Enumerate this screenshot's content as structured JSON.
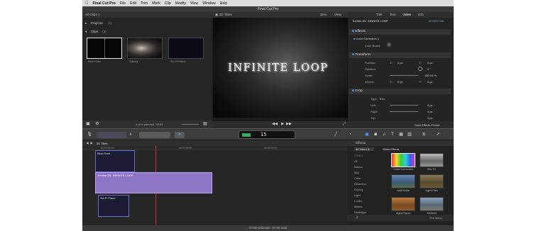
{
  "menubar": {
    "apple": "",
    "app": "Final Cut Pro",
    "items": [
      "File",
      "Edit",
      "Trim",
      "Mark",
      "Clip",
      "Modify",
      "View",
      "Window",
      "Help"
    ]
  },
  "window": {
    "title": "Final Cut Pro"
  },
  "library": {
    "header": "All Clips ◇",
    "projects_label": "Projects",
    "projects_count": "(1)",
    "clips_label": "Clips",
    "clips_count": "(3)",
    "clips": [
      {
        "name": "Blue Flare"
      },
      {
        "name": "Galaxy"
      },
      {
        "name": "Sci-Fi Plane"
      }
    ],
    "status": "1 of 4 selected, 03:03",
    "zoom": ""
  },
  "viewer": {
    "header": "3D Titles",
    "zoom": "35%",
    "view": "View",
    "title_text": "INFINITE LOOP"
  },
  "inspector": {
    "tabs": [
      "Title",
      "Text",
      "Video",
      "Info"
    ],
    "clip_name": "Tumble 3D: INFINITE LOOP",
    "clip_time": "00:00:07:00",
    "effects_label": "Effects",
    "effect_name": "Color Correction 1",
    "color_board": "Color Board",
    "transform_label": "Transform",
    "position_label": "Position:",
    "position_x_axis": "X:",
    "position_x": "0 px",
    "position_y_axis": "Y:",
    "position_y": "0 px",
    "rotation_label": "Rotation:",
    "rotation_value": "0 °",
    "scale_label": "Scale:",
    "scale_value": "100.00 %",
    "anchor_label": "Anchor:",
    "anchor_x_axis": "X:",
    "anchor_x": "0 px",
    "anchor_y_axis": "Y:",
    "anchor_y": "0 px",
    "crop_label": "Crop",
    "crop_type_label": "Type:",
    "crop_type": "Trim",
    "left_label": "Left:",
    "left_value": "0 px",
    "right_label": "Right:",
    "right_value": "0 px",
    "top_label": "Top:",
    "top_value": "0 px",
    "save_preset": "Save Effects Preset"
  },
  "toolbar": {
    "timecode": "15"
  },
  "timeline": {
    "index_label": "3D Titles",
    "ruler": [
      "00:00:00:00",
      "00:00:05:00",
      "00:00:10:00"
    ],
    "clips": [
      {
        "label": "Blue Flare"
      },
      {
        "label": "Tumble 3D: INFINITE LOOP"
      },
      {
        "label": "Sci-Fi Plane"
      }
    ]
  },
  "effects_browser": {
    "header": "Effects",
    "filter": "All Video & ...",
    "section": "Video Effects",
    "categories": [
      "VIDEO",
      "All",
      "Basics",
      "Blur",
      "Color",
      "Distortion",
      "Keying",
      "Light",
      "Looks",
      "Masks",
      "Nostalgia",
      "Stylize"
    ],
    "effects": [
      {
        "name": "Color Correction"
      },
      {
        "name": "50s TV"
      },
      {
        "name": "Add Noise"
      },
      {
        "name": "Aged Film"
      },
      {
        "name": "Aged Paper"
      },
      {
        "name": "Artifacts"
      }
    ],
    "count": "221 Items"
  },
  "status": {
    "text": "07:00 selected - 07:00 total"
  }
}
